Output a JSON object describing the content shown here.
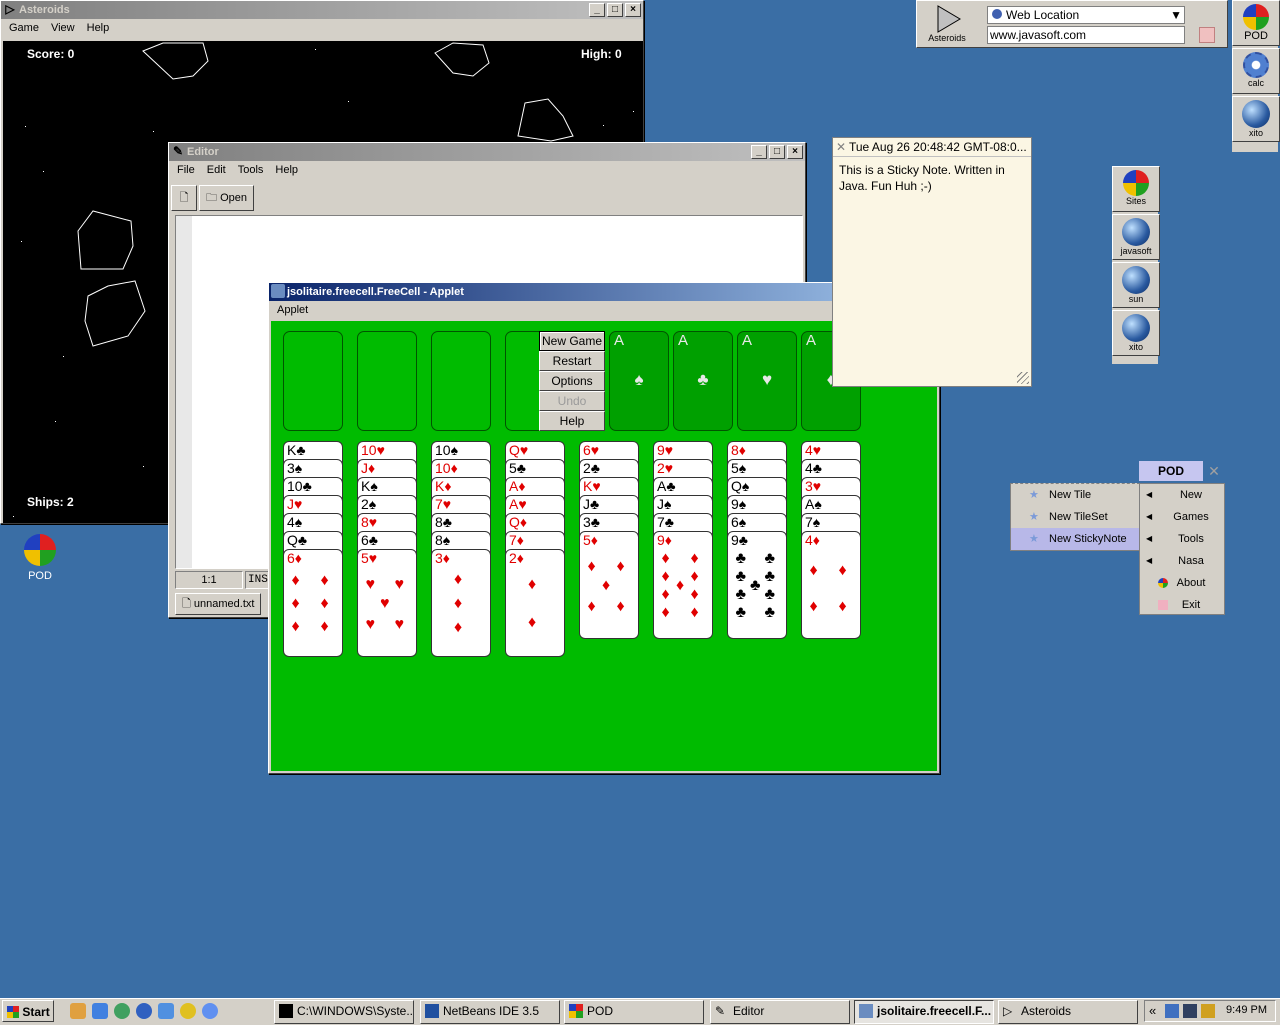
{
  "asteroids": {
    "title": "Asteroids",
    "menu": [
      "Game",
      "View",
      "Help"
    ],
    "score": "Score: 0",
    "high": "High: 0",
    "ships": "Ships: 2"
  },
  "editor": {
    "title": "Editor",
    "menu": [
      "File",
      "Edit",
      "Tools",
      "Help"
    ],
    "open_label": "Open",
    "position": "1:1",
    "mode": "INS",
    "tab": "unnamed.txt"
  },
  "freecell": {
    "title": "jsolitaire.freecell.FreeCell - Applet",
    "menu": [
      "Applet"
    ],
    "buttons": [
      "New Game",
      "Restart",
      "Options",
      "Undo",
      "Help"
    ],
    "foundation_label": "A",
    "foundation_suits": [
      "♠",
      "♣",
      "♥",
      "♦"
    ],
    "columns": [
      [
        {
          "r": "K",
          "s": "♣"
        },
        {
          "r": "3",
          "s": "♠"
        },
        {
          "r": "10",
          "s": "♣"
        },
        {
          "r": "J",
          "s": "♥"
        },
        {
          "r": "4",
          "s": "♠"
        },
        {
          "r": "Q",
          "s": "♣"
        },
        {
          "r": "6",
          "s": "♦"
        }
      ],
      [
        {
          "r": "10",
          "s": "♥"
        },
        {
          "r": "J",
          "s": "♦"
        },
        {
          "r": "K",
          "s": "♠"
        },
        {
          "r": "2",
          "s": "♠"
        },
        {
          "r": "8",
          "s": "♥"
        },
        {
          "r": "6",
          "s": "♣"
        },
        {
          "r": "5",
          "s": "♥"
        }
      ],
      [
        {
          "r": "10",
          "s": "♠"
        },
        {
          "r": "10",
          "s": "♦"
        },
        {
          "r": "K",
          "s": "♦"
        },
        {
          "r": "7",
          "s": "♥"
        },
        {
          "r": "8",
          "s": "♣"
        },
        {
          "r": "8",
          "s": "♠"
        },
        {
          "r": "3",
          "s": "♦"
        }
      ],
      [
        {
          "r": "Q",
          "s": "♥"
        },
        {
          "r": "5",
          "s": "♣"
        },
        {
          "r": "A",
          "s": "♦"
        },
        {
          "r": "A",
          "s": "♥"
        },
        {
          "r": "Q",
          "s": "♦"
        },
        {
          "r": "7",
          "s": "♦"
        },
        {
          "r": "2",
          "s": "♦"
        }
      ],
      [
        {
          "r": "6",
          "s": "♥"
        },
        {
          "r": "2",
          "s": "♣"
        },
        {
          "r": "K",
          "s": "♥"
        },
        {
          "r": "J",
          "s": "♣"
        },
        {
          "r": "3",
          "s": "♣"
        },
        {
          "r": "5",
          "s": "♦"
        }
      ],
      [
        {
          "r": "9",
          "s": "♥"
        },
        {
          "r": "2",
          "s": "♥"
        },
        {
          "r": "A",
          "s": "♣"
        },
        {
          "r": "J",
          "s": "♠"
        },
        {
          "r": "7",
          "s": "♣"
        },
        {
          "r": "9",
          "s": "♦"
        }
      ],
      [
        {
          "r": "8",
          "s": "♦"
        },
        {
          "r": "5",
          "s": "♠"
        },
        {
          "r": "Q",
          "s": "♠"
        },
        {
          "r": "9",
          "s": "♠"
        },
        {
          "r": "6",
          "s": "♠"
        },
        {
          "r": "9",
          "s": "♣"
        }
      ],
      [
        {
          "r": "4",
          "s": "♥"
        },
        {
          "r": "4",
          "s": "♣"
        },
        {
          "r": "3",
          "s": "♥"
        },
        {
          "r": "A",
          "s": "♠"
        },
        {
          "r": "7",
          "s": "♠"
        },
        {
          "r": "4",
          "s": "♦"
        }
      ]
    ],
    "felt_color": "#00bb00"
  },
  "toolbar_top": {
    "asteroids_label": "Asteroids",
    "web_location_label": "Web Location",
    "url": "www.javasoft.com"
  },
  "right_dock": [
    "POD",
    "calc",
    "xito"
  ],
  "sites_dock": [
    "Sites",
    "javasoft",
    "sun",
    "xito"
  ],
  "sticky": {
    "title": "Tue Aug 26 20:48:42 GMT-08:0...",
    "text": "This is a Sticky Note. Written in Java. Fun Huh ;-)"
  },
  "pod_menu": {
    "title": "POD",
    "items": [
      "New",
      "Games",
      "Tools",
      "Nasa",
      "About",
      "Exit"
    ],
    "submenu": [
      "New Tile",
      "New TileSet",
      "New StickyNote"
    ]
  },
  "desktop_icon": "POD",
  "taskbar": {
    "start": "Start",
    "tasks": [
      "C:\\WINDOWS\\Syste...",
      "NetBeans IDE 3.5",
      "POD",
      "Editor",
      "jsolitaire.freecell.F...",
      "Asteroids"
    ],
    "clock": "9:49 PM",
    "chevron": "«"
  }
}
